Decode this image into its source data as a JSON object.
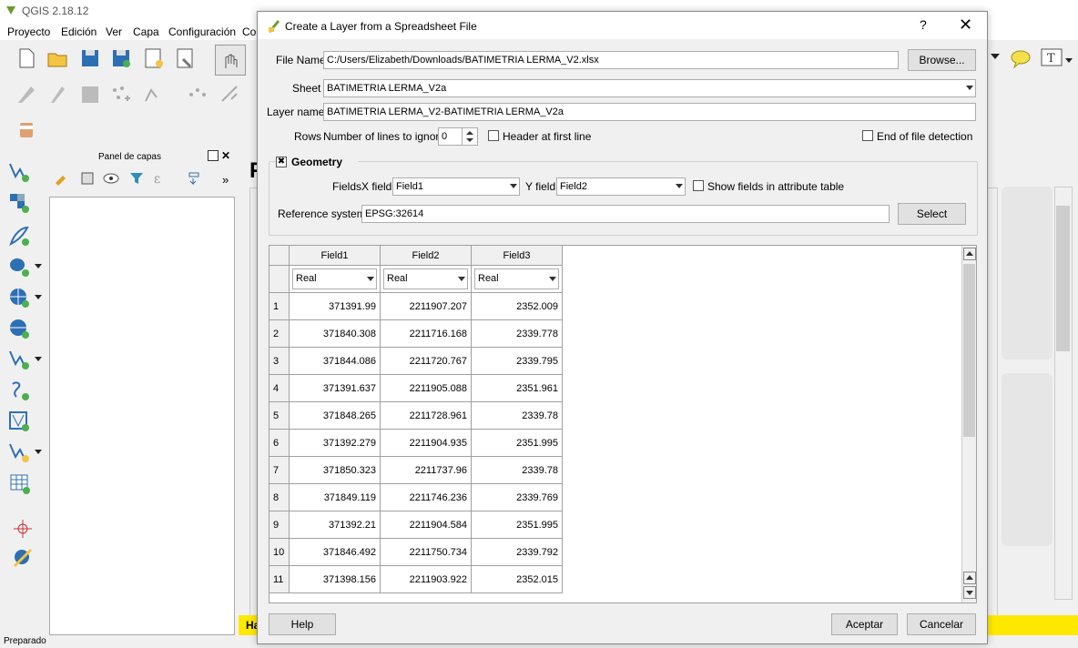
{
  "app": {
    "title": "QGIS 2.18.12",
    "menus": [
      "Proyecto",
      "Edición",
      "Ver",
      "Capa",
      "Configuración",
      "Cor"
    ]
  },
  "layers_panel": {
    "title": "Panel de capas",
    "more": "»"
  },
  "map": {
    "big_letter": "F",
    "banner_prefix": "Ha"
  },
  "statusbar": {
    "left_text": "Preparado"
  },
  "dialog": {
    "title": "Create a Layer from a Spreadsheet File",
    "help_icon": "?",
    "close_icon": "✕",
    "file_name_label": "File Name",
    "file_name_value": "C:/Users/Elizabeth/Downloads/BATIMETRIA LERMA_V2.xlsx",
    "browse_label": "Browse...",
    "sheet_label": "Sheet",
    "sheet_value": "BATIMETRIA LERMA_V2a",
    "layer_name_label": "Layer name",
    "layer_name_value": "BATIMETRIA LERMA_V2-BATIMETRIA LERMA_V2a",
    "rows_label": "Rows",
    "lines_ignore_label": "Number of lines to ignore",
    "lines_ignore_value": "0",
    "header_label": "Header at first line",
    "eof_label": "End of file detection",
    "geometry_label": "Geometry",
    "geometry_checked": "✖",
    "fields_label": "Fields",
    "x_field_label": "X field",
    "x_field_value": "Field1",
    "y_field_label": "Y field",
    "y_field_value": "Field2",
    "show_fields_label": "Show fields in attribute table",
    "ref_system_label": "Reference system",
    "ref_system_value": "EPSG:32614",
    "select_label": "Select",
    "help_button": "Help",
    "ok_button": "Aceptar",
    "cancel_button": "Cancelar"
  },
  "table": {
    "columns": [
      "Field1",
      "Field2",
      "Field3"
    ],
    "types": [
      "Real",
      "Real",
      "Real"
    ],
    "rows": [
      {
        "n": "1",
        "c": [
          "371391.99",
          "2211907.207",
          "2352.009"
        ]
      },
      {
        "n": "2",
        "c": [
          "371840.308",
          "2211716.168",
          "2339.778"
        ]
      },
      {
        "n": "3",
        "c": [
          "371844.086",
          "2211720.767",
          "2339.795"
        ]
      },
      {
        "n": "4",
        "c": [
          "371391.637",
          "2211905.088",
          "2351.961"
        ]
      },
      {
        "n": "5",
        "c": [
          "371848.265",
          "2211728.961",
          "2339.78"
        ]
      },
      {
        "n": "6",
        "c": [
          "371392.279",
          "2211904.935",
          "2351.995"
        ]
      },
      {
        "n": "7",
        "c": [
          "371850.323",
          "2211737.96",
          "2339.78"
        ]
      },
      {
        "n": "8",
        "c": [
          "371849.119",
          "2211746.236",
          "2339.769"
        ]
      },
      {
        "n": "9",
        "c": [
          "371392.21",
          "2211904.584",
          "2351.995"
        ]
      },
      {
        "n": "10",
        "c": [
          "371846.492",
          "2211750.734",
          "2339.792"
        ]
      },
      {
        "n": "11",
        "c": [
          "371398.156",
          "2211903.922",
          "2352.015"
        ]
      }
    ]
  },
  "colors": {
    "banner": "#ffe800",
    "dialog_bg": "#f0f0f0",
    "icon_green": "#4caf50",
    "icon_blue": "#2d6fb5"
  }
}
